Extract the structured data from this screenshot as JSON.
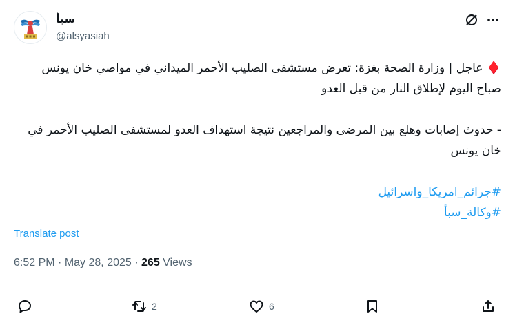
{
  "author": {
    "display_name": "سبأ",
    "handle": "@alsyasiah",
    "avatar_icon": "saba-agency-logo"
  },
  "post": {
    "lines": [
      "♦️ عاجل | وزارة الصحة بغزة: تعرض مستشفى الصليب الأحمر الميداني في مواصي خان يونس صباح اليوم لإطلاق النار من قبل العدو",
      "- حدوث إصابات وهلع بين المرضى والمراجعين نتيجة استهداف العدو لمستشفى الصليب الأحمر في خان يونس"
    ],
    "headline_prefix": "♦️",
    "headline_text": "عاجل | وزارة الصحة بغزة: تعرض مستشفى الصليب الأحمر الميداني في مواصي خان يونس صباح اليوم لإطلاق النار من قبل العدو",
    "detail_text": "- حدوث إصابات وهلع بين المرضى والمراجعين نتيجة استهداف العدو لمستشفى الصليب الأحمر في خان يونس",
    "hashtags": [
      "#جرائم_امريكا_واسرائيل",
      "#وكالة_سبأ"
    ]
  },
  "translate_label": "Translate post",
  "meta": {
    "time": "6:52 PM",
    "separator": "·",
    "date": "May 28, 2025",
    "views_count": "265",
    "views_label": "Views"
  },
  "actions": {
    "reply_count": "",
    "repost_count": "2",
    "like_count": "6"
  },
  "colors": {
    "accent": "#1d9bf0",
    "text": "#0f1419",
    "muted": "#536471",
    "diamond": "#c8102e"
  }
}
